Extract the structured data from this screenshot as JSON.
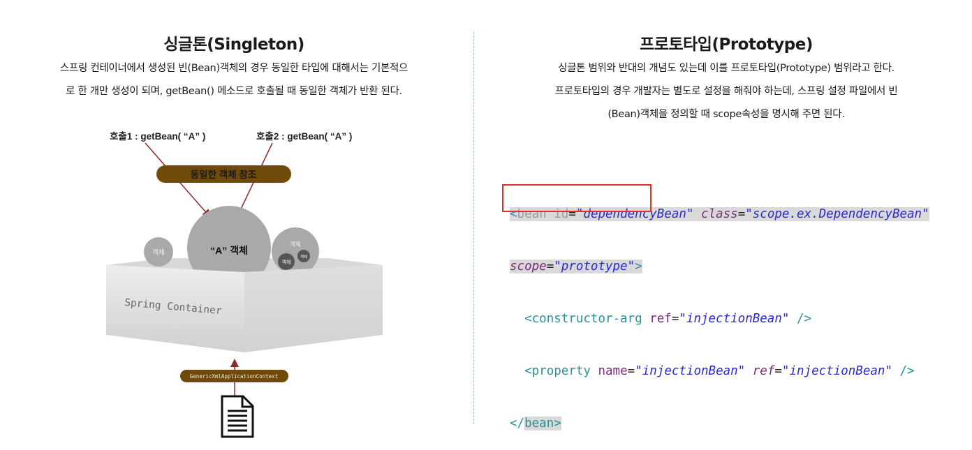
{
  "singleton": {
    "title": "싱글톤(Singleton)",
    "desc_line1": "스프링 컨테이너에서 생성된 빈(Bean)객체의 경우 동일한 타입에 대해서는 기본적으",
    "desc_line2": "로 한 개만 생성이 되며, getBean() 메소드로 호출될 때 동일한 객체가 반환 된다."
  },
  "diagram": {
    "call1": "호출1 : getBean( “A” )",
    "call2": "호출2 : getBean( “A” )",
    "banner": "동일한 객체 참조",
    "main_object": "“A” 객체",
    "object_small": "객체",
    "object_right_top": "객체",
    "object_right_a": "객체",
    "object_right_b": "객체",
    "container": "Spring Container",
    "context": "GenericXmlApplicationContext",
    "colors": {
      "banner": "#6f4a0b",
      "context": "#6f4a0b",
      "arrow": "#8b2a2a"
    }
  },
  "prototype": {
    "title": "프로토타입(Prototype)",
    "desc_line1": "싱글톤 범위와 반대의 개념도 있는데 이를 프로토타입(Prototype) 범위라고 한다.",
    "desc_line2": "프로토타입의 경우 개발자는 별도로 설정을 해줘야 하는데, 스프링 설정 파일에서 빈",
    "desc_line3": "(Bean)객체을 정의할 때 scope속성을 명시해 주면 된다."
  },
  "code": {
    "open_bracket": "<",
    "close_bracket": ">",
    "self_close": "/>",
    "end_open": "</",
    "eq": "=",
    "l1_tag": "bean",
    "l1_attr1": "id",
    "l1_val1": "\"dependencyBean\"",
    "l1_attr2": "class",
    "l1_val2": "\"scope.ex.DependencyBean\"",
    "l2_attr": "scope",
    "l2_val": "\"prototype\"",
    "l3_tag": "constructor-arg",
    "l3_attr": "ref",
    "l3_val": "\"injectionBean\"",
    "l4_tag": "property",
    "l4_attr1": "name",
    "l4_val1": "\"injectionBean\"",
    "l4_attr2": "ref",
    "l4_val2": "\"injectionBean\"",
    "l5_tag": "bean"
  }
}
